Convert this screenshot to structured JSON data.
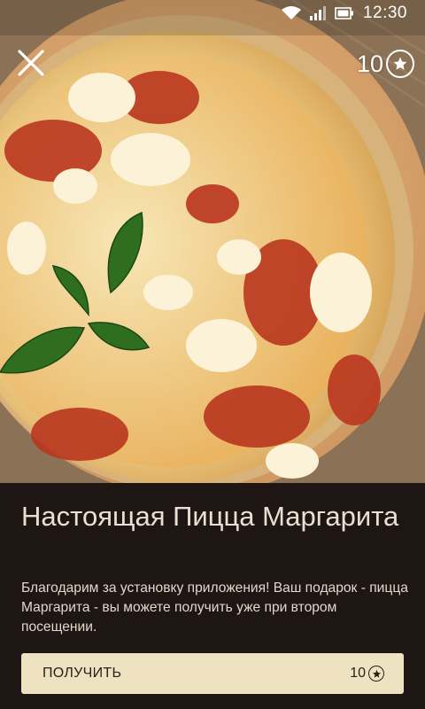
{
  "status_bar": {
    "time": "12:30",
    "icons": [
      "wifi-icon",
      "signal-icon",
      "battery-icon"
    ]
  },
  "header": {
    "close_icon": "close-icon",
    "points": "10",
    "points_icon": "star-badge-icon"
  },
  "hero": {
    "image": "pizza-margherita-photo"
  },
  "offer": {
    "title": "Настоящая Пицца Маргарита",
    "description": "Благодарим за установку приложения!  Ваш подарок - пицца Маргарита - вы можете получить уже при втором посещении.",
    "button_label": "ПОЛУЧИТЬ",
    "button_cost": "10",
    "button_cost_icon": "star-coin-icon"
  },
  "colors": {
    "panel_bg": "#1e1613",
    "button_bg": "#efe2c0",
    "title_text": "#e9dfd2",
    "button_text": "#2a211b"
  }
}
